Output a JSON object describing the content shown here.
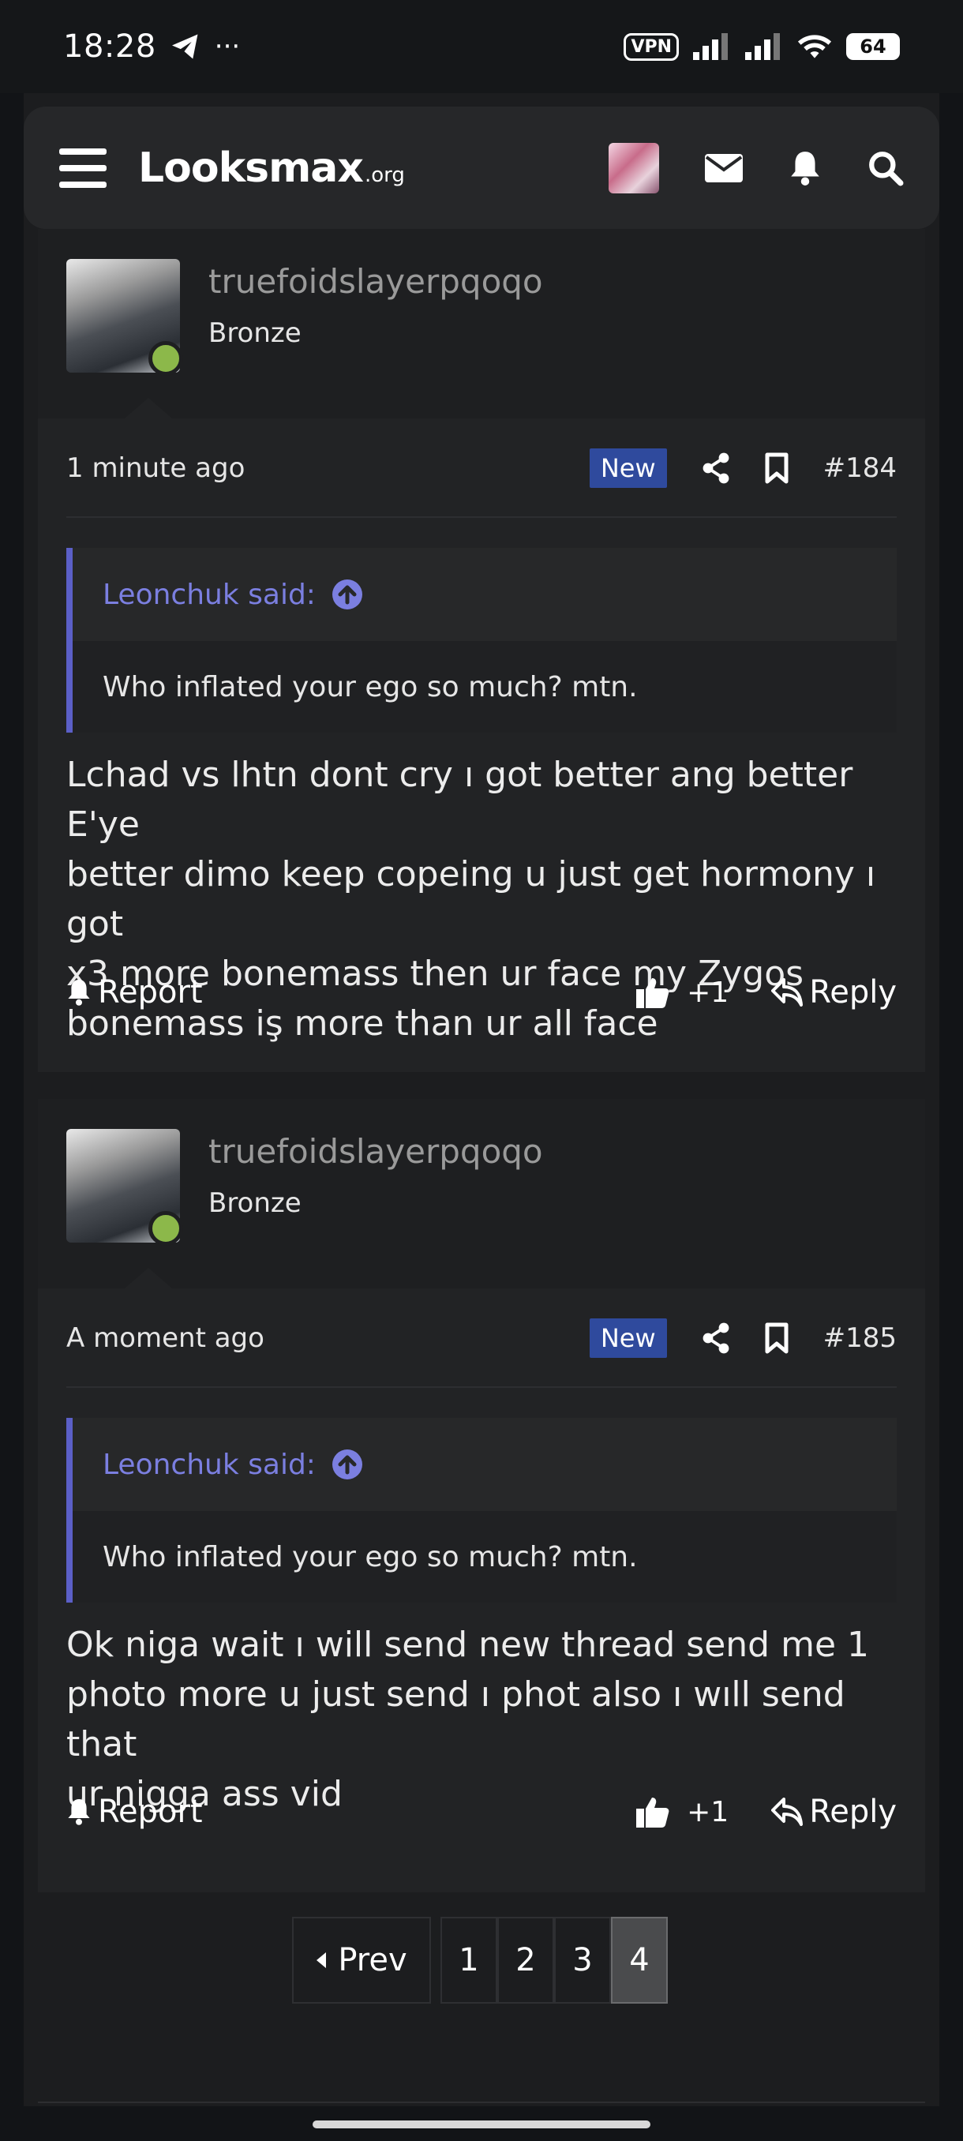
{
  "status_bar": {
    "time": "18:28",
    "vpn": "VPN",
    "battery": "64"
  },
  "header": {
    "logo_main": "Looksmax",
    "logo_suffix": ".org"
  },
  "posts": [
    {
      "username": "truefoidslayerpqoqo",
      "rank": "Bronze",
      "time": "1 minute ago",
      "badge": "New",
      "number": "#184",
      "quote_author": "Leonchuk said:",
      "quote_text": "Who inflated your ego so much? mtn.",
      "text_lines": [
        "Lchad vs lhtn dont cry ı got better ang better E'ye",
        "better dimo keep copeing u just get hormony ı got",
        "x3 more bonemass then ur face my Zygos",
        "bonemass iş more than ur all face"
      ],
      "report_label": "Report",
      "reaction_count": "+1",
      "reply_label": "Reply"
    },
    {
      "username": "truefoidslayerpqoqo",
      "rank": "Bronze",
      "time": "A moment ago",
      "badge": "New",
      "number": "#185",
      "quote_author": "Leonchuk said:",
      "quote_text": "Who inflated your ego so much? mtn.",
      "text_lines": [
        "Ok niga wait ı will send new thread send me 1",
        "photo more u just send ı phot also ı wıll send that",
        "ur nigga ass vid"
      ],
      "report_label": "Report",
      "reaction_count": "+1",
      "reply_label": "Reply"
    }
  ],
  "pagination": {
    "prev_label": "Prev",
    "pages": [
      "1",
      "2",
      "3",
      "4"
    ],
    "current": "4"
  },
  "icons": {
    "menu": "hamburger-menu-icon",
    "mail": "envelope-icon",
    "bell": "bell-icon",
    "search": "search-icon",
    "share": "share-icon",
    "bookmark": "bookmark-icon",
    "upvote": "arrow-up-circle-icon",
    "thumbs_up": "thumbs-up-icon",
    "reply": "reply-arrow-icon"
  },
  "colors": {
    "accent_quote": "#5b5fc7",
    "new_badge": "#2f4a9d",
    "online": "#8cb84a"
  }
}
